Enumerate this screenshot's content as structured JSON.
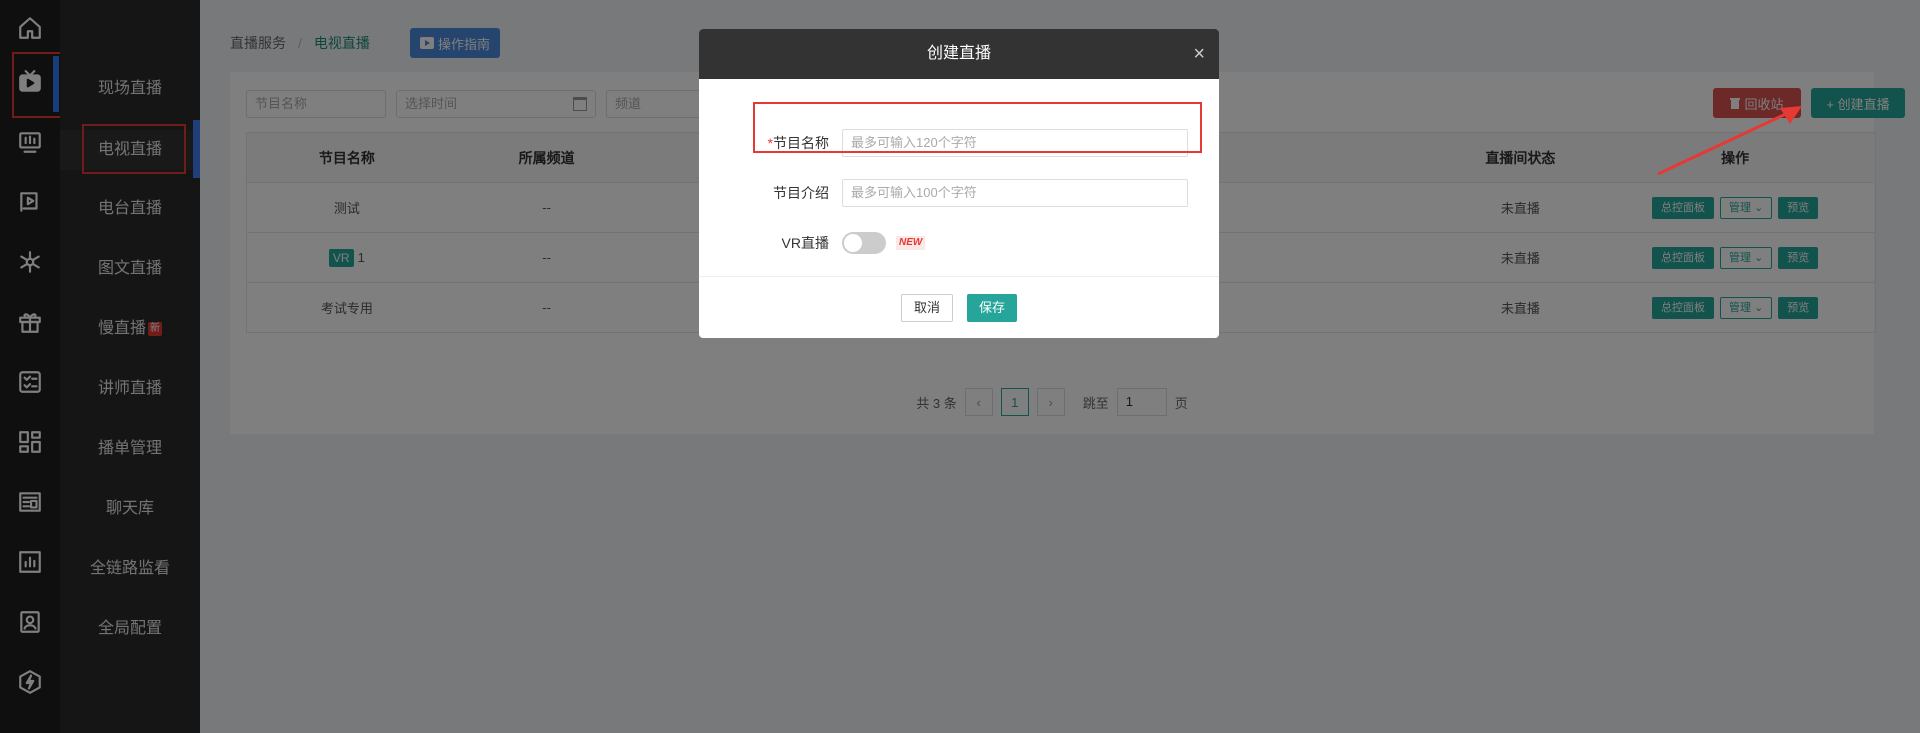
{
  "rail": {
    "icons": [
      "home-icon",
      "live-tv-icon",
      "monitor-icon",
      "video-icon",
      "network-icon",
      "gift-icon",
      "checklist-icon",
      "dashboard-icon",
      "news-icon",
      "chart-icon",
      "user-card-icon",
      "lightning-icon"
    ]
  },
  "submenu": {
    "items": [
      {
        "label": "现场直播"
      },
      {
        "label": "电视直播"
      },
      {
        "label": "电台直播"
      },
      {
        "label": "图文直播"
      },
      {
        "label": "慢直播",
        "badge": "新"
      },
      {
        "label": "讲师直播"
      },
      {
        "label": "播单管理"
      },
      {
        "label": "聊天库"
      },
      {
        "label": "全链路监看"
      },
      {
        "label": "全局配置"
      }
    ]
  },
  "breadcrumb": {
    "root": "直播服务",
    "sep": "/",
    "current": "电视直播"
  },
  "guide_button": "操作指南",
  "filters": {
    "name_placeholder": "节目名称",
    "time_placeholder": "选择时间",
    "channel_placeholder": "频道"
  },
  "toolbar": {
    "recycle_label": "回收站",
    "create_label": "+ 创建直播"
  },
  "table": {
    "headers": [
      "节目名称",
      "所属频道",
      "",
      "",
      "直播间状态",
      "操作"
    ],
    "rows": [
      {
        "name": "测试",
        "vr": "",
        "channel": "--",
        "status": "未直播"
      },
      {
        "name": "1",
        "vr": "VR",
        "channel": "--",
        "status": "未直播"
      },
      {
        "name": "考试专用",
        "vr": "",
        "channel": "--",
        "status": "未直播"
      }
    ],
    "ops": {
      "panel": "总控面板",
      "manage": "管理 ⌄",
      "preview": "预览"
    }
  },
  "pagination": {
    "total": "共 3 条",
    "prev": "‹",
    "current": "1",
    "next": "›",
    "jump": "跳至",
    "page_value": "1",
    "page_unit": "页"
  },
  "modal": {
    "title": "创建直播",
    "close": "×",
    "name_required": "*",
    "name_label": "节目名称",
    "name_placeholder": "最多可输入120个字符",
    "intro_label": "节目介绍",
    "intro_placeholder": "最多可输入100个字符",
    "vr_label": "VR直播",
    "vr_new": "NEW",
    "vr_enabled": false,
    "cancel": "取消",
    "save": "保存"
  },
  "colors": {
    "accent": "#26a69a",
    "danger": "#d9534f",
    "rail_active": "#2f7cf6",
    "annotation": "#e53935"
  }
}
